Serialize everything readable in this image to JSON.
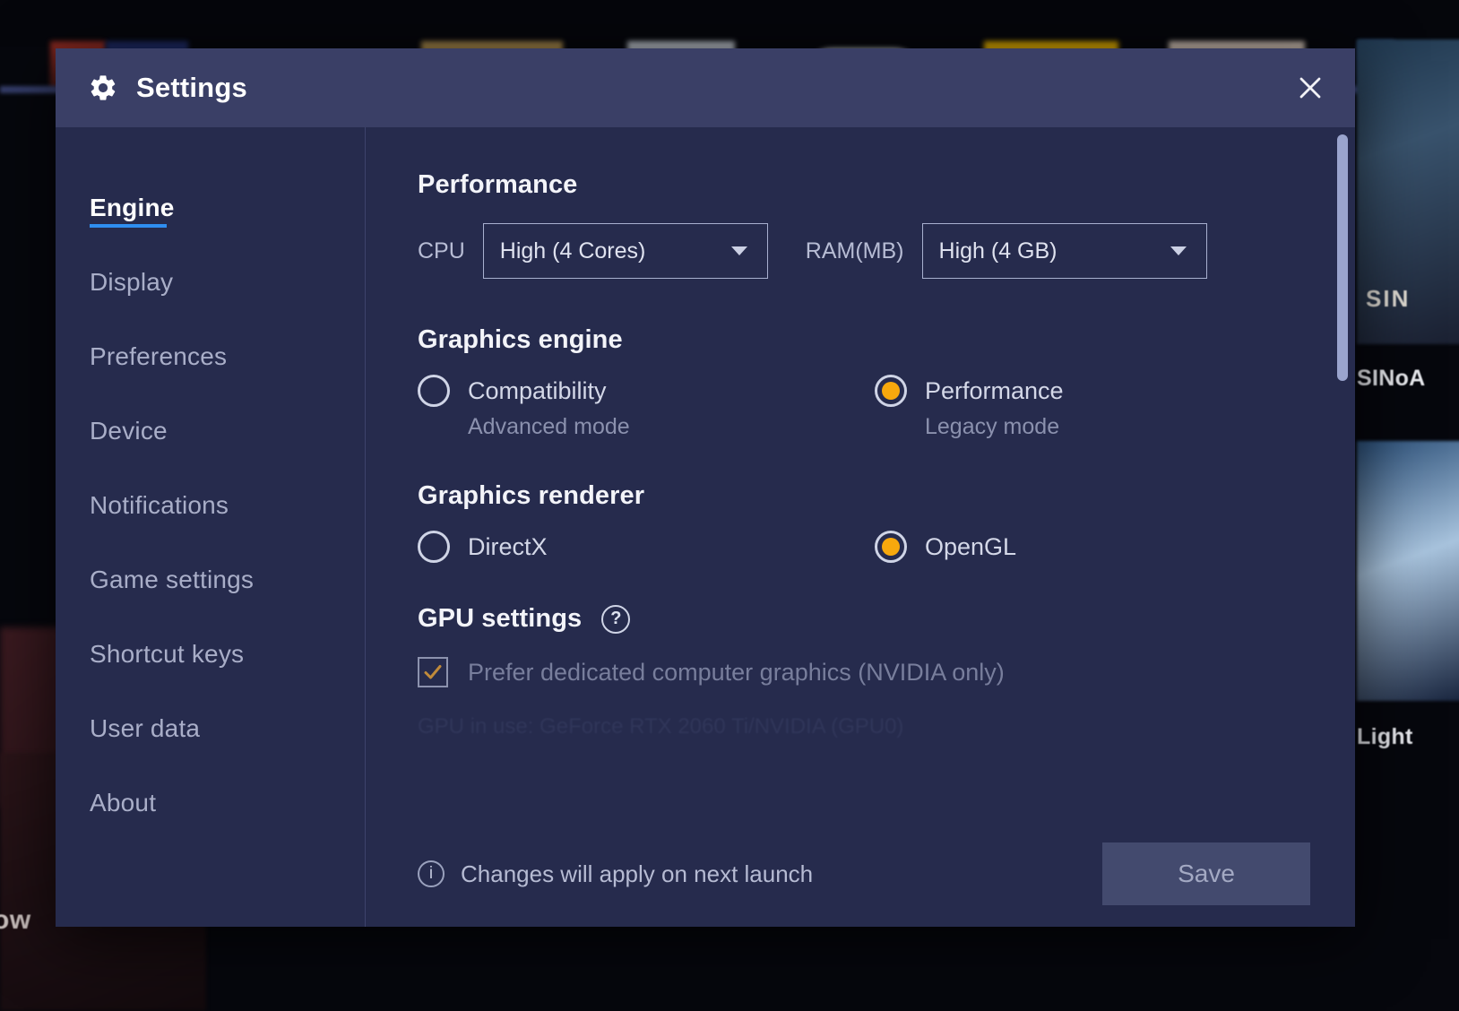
{
  "window": {
    "title": "Settings",
    "gear_icon": "gear-icon",
    "close_icon": "close-icon"
  },
  "sidebar": {
    "items": [
      {
        "label": "Engine",
        "active": true
      },
      {
        "label": "Display",
        "active": false
      },
      {
        "label": "Preferences",
        "active": false
      },
      {
        "label": "Device",
        "active": false
      },
      {
        "label": "Notifications",
        "active": false
      },
      {
        "label": "Game settings",
        "active": false
      },
      {
        "label": "Shortcut keys",
        "active": false
      },
      {
        "label": "User data",
        "active": false
      },
      {
        "label": "About",
        "active": false
      }
    ]
  },
  "performance": {
    "heading": "Performance",
    "cpu_label": "CPU",
    "cpu_value": "High (4 Cores)",
    "ram_label": "RAM(MB)",
    "ram_value": "High (4 GB)"
  },
  "graphics_engine": {
    "heading": "Graphics engine",
    "options": [
      {
        "label": "Compatibility",
        "sub": "Advanced mode",
        "selected": false
      },
      {
        "label": "Performance",
        "sub": "Legacy mode",
        "selected": true
      }
    ]
  },
  "graphics_renderer": {
    "heading": "Graphics renderer",
    "options": [
      {
        "label": "DirectX",
        "selected": false
      },
      {
        "label": "OpenGL",
        "selected": true
      }
    ]
  },
  "gpu_settings": {
    "heading": "GPU settings",
    "help_icon": "?",
    "checkbox_label": "Prefer dedicated computer graphics (NVIDIA only)",
    "checkbox_checked": true,
    "detail": "GPU in use: GeForce RTX 2060 Ti/NVIDIA (GPU0)"
  },
  "footer": {
    "info_icon": "i",
    "note": "Changes will apply on next launch",
    "save_label": "Save"
  },
  "background": {
    "bottom_left_label": "ow",
    "right_cards": [
      {
        "label": "SINoA"
      },
      {
        "label": "Light"
      }
    ],
    "right_card_overlay": "SIN"
  },
  "colors": {
    "accent_blue": "#2f8ef0",
    "accent_orange": "#f7a80d",
    "dialog_bg": "#262b4d",
    "titlebar_bg": "#3a3f66"
  }
}
